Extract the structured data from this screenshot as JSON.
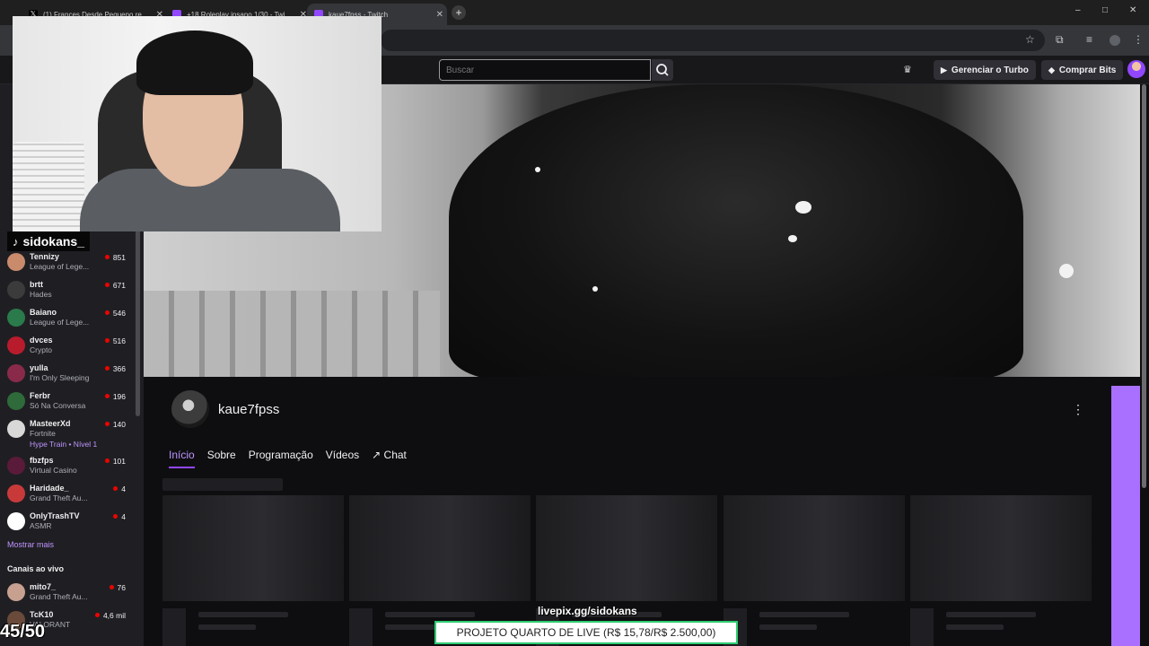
{
  "browser": {
    "tabs": [
      {
        "title": "(1) Frances Desde Pequeno re...",
        "icon": "x-logo-icon"
      },
      {
        "title": "+18 Roleplay insano 1/30 - Twi...",
        "icon": "twitch-icon"
      },
      {
        "title": "kaue7fpss - Twitch",
        "icon": "twitch-icon"
      }
    ],
    "new_tab": "+",
    "window_controls": {
      "minimize": "–",
      "maximize": "□",
      "close": "✕"
    }
  },
  "topnav": {
    "search_placeholder": "Buscar",
    "turbo_label": "Gerenciar o Turbo",
    "bits_label": "Comprar Bits"
  },
  "sidebar": {
    "channels": [
      {
        "name": "Tennizy",
        "game": "League of Lege...",
        "viewers": "851",
        "color": "#c98b6b"
      },
      {
        "name": "brtt",
        "game": "Hades",
        "viewers": "671",
        "color": "#3b3b3b"
      },
      {
        "name": "Baiano",
        "game": "League of Lege...",
        "viewers": "546",
        "color": "#2a7a4b"
      },
      {
        "name": "dvces",
        "game": "Crypto",
        "viewers": "516",
        "color": "#b81c2c"
      },
      {
        "name": "yulla",
        "game": "I'm Only Sleeping",
        "viewers": "366",
        "color": "#8a2a4a"
      },
      {
        "name": "Ferbr",
        "game": "Só Na Conversa",
        "viewers": "196",
        "color": "#2f6a3a"
      },
      {
        "name": "MasteerXd",
        "game": "Fortnite",
        "viewers": "140",
        "color": "#d8d8d8",
        "hype": "Hype Train • Nível 1"
      },
      {
        "name": "fbzfps",
        "game": "Virtual Casino",
        "viewers": "101",
        "color": "#5a1a3a"
      },
      {
        "name": "Haridade_",
        "game": "Grand Theft Au...",
        "viewers": "4",
        "color": "#c83a3a"
      },
      {
        "name": "OnlyTrashTV",
        "game": "ASMR",
        "viewers": "4",
        "color": "#ffffff"
      }
    ],
    "show_more": "Mostrar mais",
    "live_header": "Canais ao vivo",
    "live_channels": [
      {
        "name": "mito7_",
        "game": "Grand Theft Au...",
        "viewers": "76",
        "color": "#c8a090"
      },
      {
        "name": "TcK10",
        "game": "VALORANT",
        "viewers": "4,6 mil",
        "color": "#6a4a3a"
      }
    ]
  },
  "channel": {
    "name": "kaue7fpss",
    "tabs": [
      "Início",
      "Sobre",
      "Programação",
      "Vídeos",
      "Chat"
    ],
    "active_tab": "Início"
  },
  "overlay": {
    "tiktok_handle": "sidokans_",
    "counter": "45/50",
    "livepix": "livepix.gg/sidokans",
    "goal": "PROJETO QUARTO DE LIVE (R$ 15,78/R$ 2.500,00)"
  },
  "colors": {
    "twitch_purple": "#9147ff",
    "accent_purple": "#bf94ff",
    "live_red": "#eb0400",
    "goal_border": "#2ecc71"
  }
}
